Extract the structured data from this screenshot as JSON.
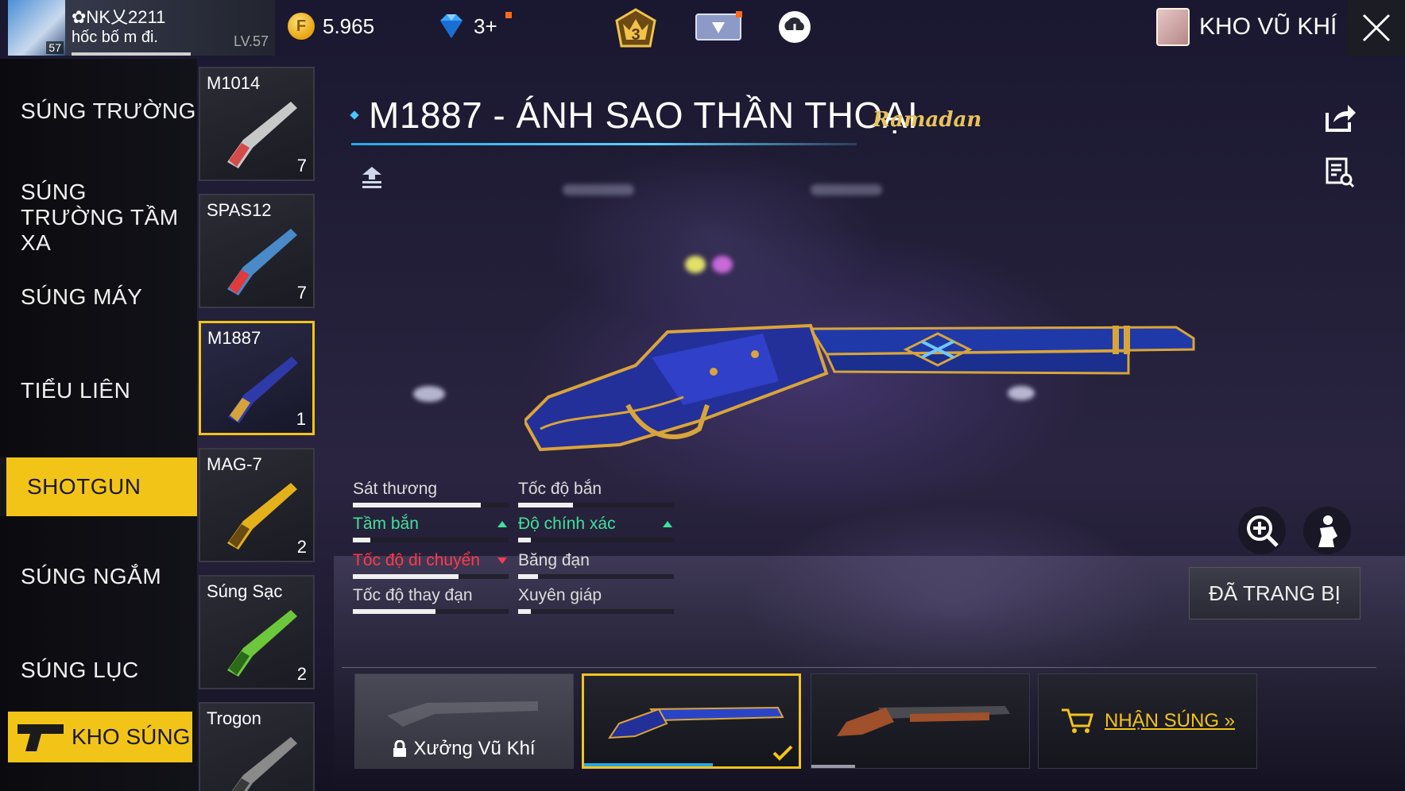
{
  "player": {
    "name": "✿NK乂2211",
    "status": "hốc bố m đi.",
    "level": "LV.57",
    "avatar_level": "57",
    "xp_progress": 0.6
  },
  "currency": {
    "gold": "5.965",
    "diamonds": "3+"
  },
  "header": {
    "rank_badge": "3",
    "screen_title": "KHO VŨ KHÍ"
  },
  "nav": {
    "items": [
      {
        "label": "SÚNG TRƯỜNG"
      },
      {
        "label": "SÚNG TRƯỜNG TẦM XA"
      },
      {
        "label": "SÚNG MÁY"
      },
      {
        "label": "TIỂU LIÊN"
      },
      {
        "label": "SHOTGUN"
      },
      {
        "label": "SÚNG NGẮM"
      },
      {
        "label": "SÚNG LỤC"
      }
    ],
    "active_index": 4,
    "footer_button": "KHO SÚNG"
  },
  "weapons": [
    {
      "name": "M1014",
      "count": "7",
      "color": "#c8c8c8",
      "accent": "#d64a4a"
    },
    {
      "name": "SPAS12",
      "count": "7",
      "color": "#4a8ac8",
      "accent": "#e03a3a"
    },
    {
      "name": "M1887",
      "count": "1",
      "color": "#2e3aa8",
      "accent": "#d6a23a"
    },
    {
      "name": "MAG-7",
      "count": "2",
      "color": "#e3b21a",
      "accent": "#6a4a10"
    },
    {
      "name": "Súng Sạc",
      "count": "2",
      "color": "#6cc83a",
      "accent": "#2a6a1a"
    },
    {
      "name": "Trogon",
      "count": "",
      "color": "#8a8a8a",
      "accent": "#3a3a3a"
    }
  ],
  "selected_weapon_index": 2,
  "detail": {
    "title": "M1887 - ÁNH SAO THẦN THOẠI",
    "event_tag": "Ramadan",
    "equipped_label": "ĐÃ TRANG BỊ"
  },
  "stats": [
    {
      "label": "Sát thương",
      "value": 0.82,
      "trend": "none"
    },
    {
      "label": "Tốc độ bắn",
      "value": 0.35,
      "trend": "none"
    },
    {
      "label": "Tầm bắn",
      "value": 0.11,
      "trend": "up"
    },
    {
      "label": "Độ chính xác",
      "value": 0.08,
      "trend": "up"
    },
    {
      "label": "Tốc độ di chuyển",
      "value": 0.68,
      "trend": "down"
    },
    {
      "label": "Băng đạn",
      "value": 0.13,
      "trend": "none"
    },
    {
      "label": "Tốc độ thay đạn",
      "value": 0.53,
      "trend": "none"
    },
    {
      "label": "Xuyên giáp",
      "value": 0.08,
      "trend": "none"
    }
  ],
  "skins": {
    "workshop_label": "Xưởng Vũ Khí",
    "buy_label": "NHẬN SÚNG »"
  },
  "colors": {
    "accent_yellow": "#f3c418",
    "accent_blue": "#2aa6e6",
    "stat_up": "#3fe29a",
    "stat_down": "#ff3a4a"
  },
  "icons": [
    "gold-coin-icon",
    "diamond-icon",
    "rank-badge-icon",
    "card-icon",
    "cloud-download-icon",
    "book-icon",
    "close-icon",
    "share-icon",
    "search-list-icon",
    "compare-icon",
    "zoom-in-icon",
    "character-icon",
    "lock-icon",
    "cart-icon",
    "gun-icon",
    "checkmark-icon"
  ]
}
